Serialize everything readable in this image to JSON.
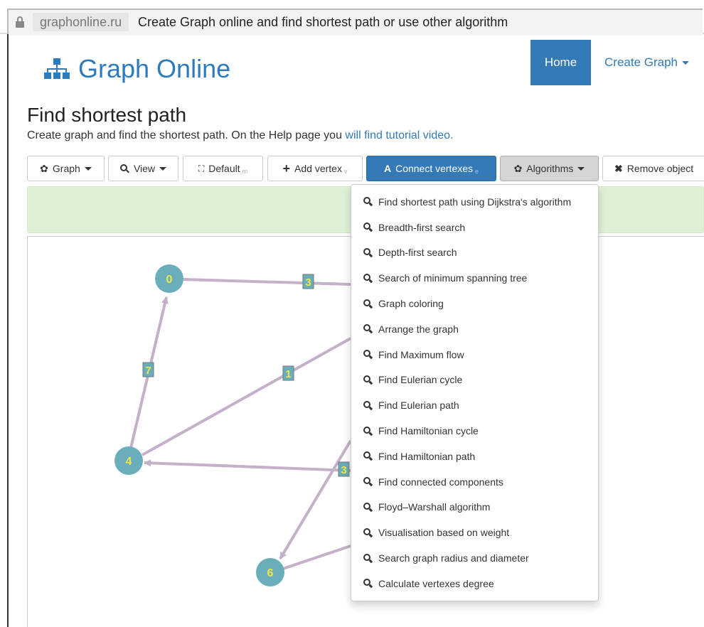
{
  "browser": {
    "domain": "graphonline.ru",
    "tab_title": "Create Graph online and find shortest path or use other algorithm"
  },
  "navbar": {
    "logo_text": "Graph Online",
    "home": "Home",
    "create_graph": "Create Graph"
  },
  "page": {
    "title": "Find shortest path",
    "subtitle_text": "Create graph and find the shortest path. On the Help page you ",
    "subtitle_link": "will find tutorial video."
  },
  "toolbar": {
    "graph": "Graph",
    "view": "View",
    "default": "Default",
    "default_key": "m",
    "add_vertex": "Add vertex",
    "add_vertex_key": "v",
    "connect_vertexes": "Connect vertexes",
    "connect_vertexes_key": "e",
    "algorithms": "Algorithms",
    "remove_object": "Remove object"
  },
  "algorithms_menu": [
    "Find shortest path using Dijkstra's algorithm",
    "Breadth-first search",
    "Depth-first search",
    "Search of minimum spanning tree",
    "Graph coloring",
    "Arrange the graph",
    "Find Maximum flow",
    "Find Eulerian cycle",
    "Find Eulerian path",
    "Find Hamiltonian cycle",
    "Find Hamiltonian path",
    "Find connected components",
    "Floyd–Warshall algorithm",
    "Visualisation based on weight",
    "Search graph radius and diameter",
    "Calculate vertexes degree"
  ],
  "graph": {
    "vertices": [
      "0",
      "4",
      "6"
    ],
    "edge_weights": [
      "3",
      "7",
      "1",
      "3"
    ]
  },
  "colors": {
    "primary": "#337ab7",
    "vertex_fill": "#6aaebc",
    "vertex_label": "#f0e64a",
    "edge": "#c4b0c8",
    "alert_bg": "#dff0d8"
  }
}
